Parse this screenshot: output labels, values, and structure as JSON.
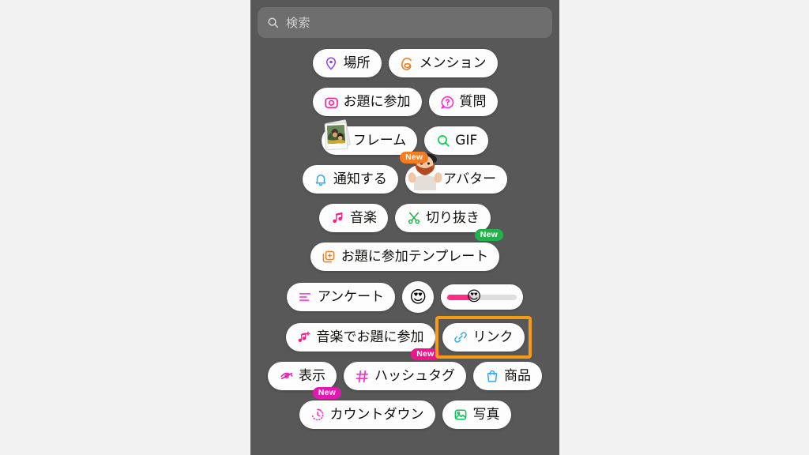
{
  "panel": {
    "background_color": "#585858",
    "page_background_color": "#f2f2f2"
  },
  "search": {
    "placeholder": "検索",
    "value": "",
    "icon": "search-icon"
  },
  "highlight": {
    "target": "link-pill",
    "color": "#f59b14"
  },
  "rows": [
    {
      "items": [
        {
          "label": "場所",
          "icon": "location-pin-icon",
          "icon_color": "#8b3ff5"
        },
        {
          "label": "メンション",
          "icon": "threads-at-icon",
          "icon_color": "#f57c20"
        }
      ]
    },
    {
      "items": [
        {
          "label": "お題に参加",
          "icon": "camera-icon",
          "icon_color": "#ff1a8c"
        },
        {
          "label": "質問",
          "icon": "question-bubble-icon",
          "icon_color": "#ff2ad0"
        }
      ]
    },
    {
      "items": [
        {
          "label": "フレーム",
          "icon": "polaroid-photo-icon",
          "badge": "New",
          "badge_color": "#f57c20"
        },
        {
          "label": "GIF",
          "icon": "search-gif-icon",
          "icon_color": "#00d14b"
        }
      ]
    },
    {
      "items": [
        {
          "label": "通知する",
          "icon": "bell-icon",
          "icon_color": "#2fa8f5"
        },
        {
          "label": "アバター",
          "icon": "avatar-person-icon"
        }
      ]
    },
    {
      "items": [
        {
          "label": "音楽",
          "icon": "music-note-icon",
          "icon_color": "#ff1a8c"
        },
        {
          "label": "切り抜き",
          "icon": "scissors-icon",
          "icon_color": "#22b24c",
          "badge": "New",
          "badge_color": "#22b24c"
        }
      ]
    },
    {
      "items": [
        {
          "label": "お題に参加テンプレート",
          "icon": "template-add-icon",
          "icon_color": "#f57c20"
        }
      ]
    },
    {
      "items": [
        {
          "label": "アンケート",
          "icon": "poll-bars-icon",
          "icon_color": "#ff2ad0"
        },
        {
          "label": "",
          "icon": "heart-eyes-emoji",
          "emoji": "😍",
          "shape": "circle"
        },
        {
          "label": "",
          "icon": "emoji-slider",
          "emoji": "😍",
          "shape": "slider",
          "fill_percent": 34,
          "track_color": "#dedede",
          "fill_color": "#ff2d86"
        }
      ]
    },
    {
      "items": [
        {
          "label": "音楽でお題に参加",
          "icon": "music-note-plus-icon",
          "icon_color": "#ff1a8c",
          "badge": "New",
          "badge_color": "#f0148c"
        },
        {
          "label": "リンク",
          "icon": "link-chain-icon",
          "icon_color": "#2fa8f5",
          "highlighted": true
        }
      ]
    },
    {
      "items": [
        {
          "label": "表示",
          "icon": "eye-slash-icon",
          "icon_color": "#e318b0",
          "badge": "New",
          "badge_color": "#e318b0"
        },
        {
          "label": "ハッシュタグ",
          "icon": "hashtag-icon",
          "icon_color": "#ff2ad0"
        },
        {
          "label": "商品",
          "icon": "shopping-bag-icon",
          "icon_color": "#2fa8f5"
        }
      ]
    },
    {
      "items": [
        {
          "label": "カウントダウン",
          "icon": "countdown-timer-icon",
          "icon_color": "#ff2ad0"
        },
        {
          "label": "写真",
          "icon": "photo-icon",
          "icon_color": "#00c853"
        }
      ]
    }
  ]
}
